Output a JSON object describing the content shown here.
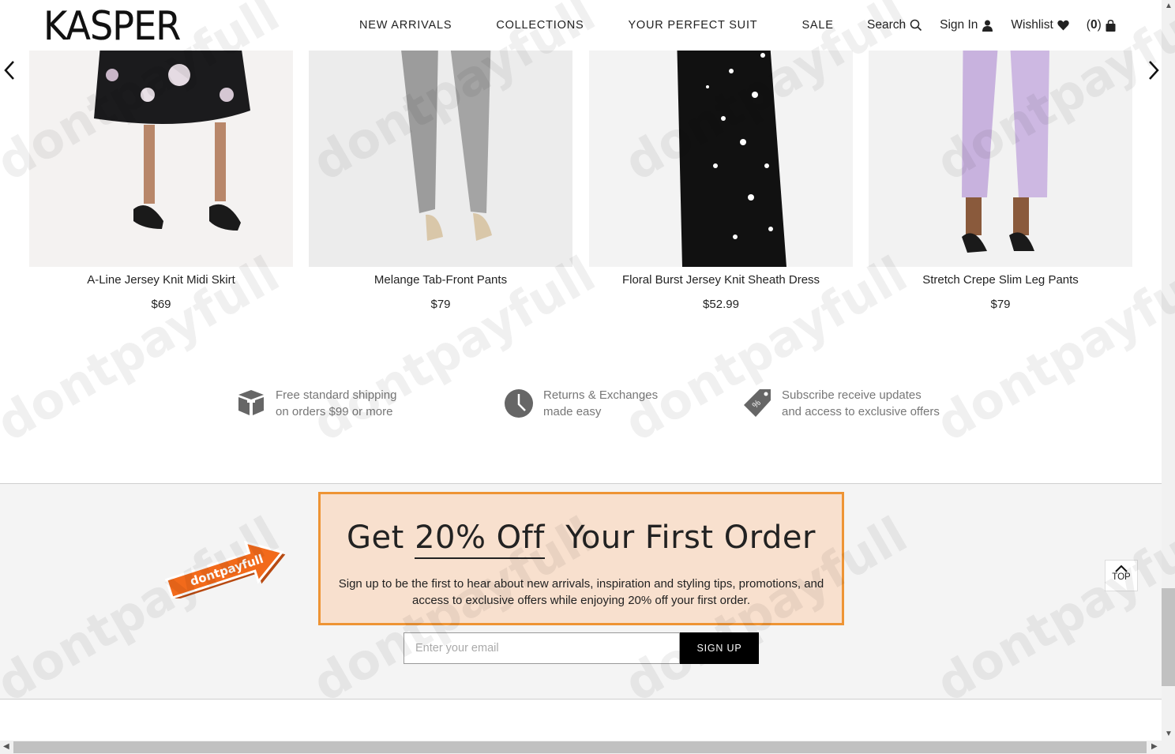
{
  "header": {
    "logo": "KASPER",
    "nav": [
      "NEW ARRIVALS",
      "COLLECTIONS",
      "YOUR PERFECT SUIT",
      "SALE"
    ],
    "search_label": "Search",
    "signin_label": "Sign In",
    "wishlist_label": "Wishlist",
    "cart_open": "(",
    "cart_count": "0",
    "cart_close": ")"
  },
  "products": [
    {
      "name": "A-Line Jersey Knit Midi Skirt",
      "price": "$69"
    },
    {
      "name": "Melange Tab-Front Pants",
      "price": "$79"
    },
    {
      "name": "Floral Burst Jersey Knit Sheath Dress",
      "price": "$52.99"
    },
    {
      "name": "Stretch Crepe Slim Leg Pants",
      "price": "$79"
    }
  ],
  "benefits": [
    {
      "line1": "Free standard shipping",
      "line2": "on orders $99 or more",
      "icon": "box-icon"
    },
    {
      "line1": "Returns & Exchanges",
      "line2": "made easy",
      "icon": "clock-icon"
    },
    {
      "line1": "Subscribe receive updates",
      "line2": "and access to exclusive offers",
      "icon": "tag-icon"
    }
  ],
  "newsletter": {
    "title_pre": "Get ",
    "title_highlight": "20% Off",
    "title_post": "  Your First Order",
    "description": "Sign up to be the first to hear about new arrivals, inspiration and styling tips, promotions, and access to exclusive offers while enjoying 20% off your first order.",
    "email_placeholder": "Enter your email",
    "signup_label": "SIGN UP"
  },
  "top_button_label": "TOP",
  "sticker_text": "dontpayfull",
  "watermark_text": "dontpayfull",
  "colors": {
    "promo_bg": "#f8e0ce",
    "promo_border": "#ee9434",
    "sticker": "#f26a1b"
  }
}
